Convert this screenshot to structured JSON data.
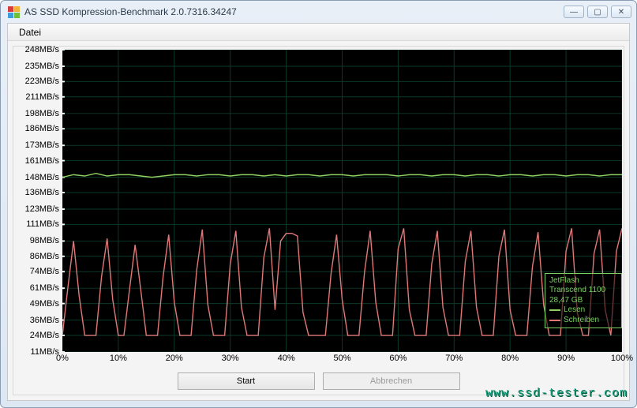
{
  "window": {
    "title": "AS SSD Kompression-Benchmark 2.0.7316.34247",
    "icon_colors": [
      "#d93b3b",
      "#f2b233",
      "#3b9dd9",
      "#6fbf3b"
    ]
  },
  "menu": {
    "file": "Datei"
  },
  "buttons": {
    "start": "Start",
    "cancel": "Abbrechen"
  },
  "win_controls": {
    "min": "—",
    "max": "▢",
    "close": "✕"
  },
  "legend": {
    "device": "JetFlash Transcend 1100",
    "capacity": "28,47 GB",
    "read": "Lesen",
    "write": "Schreiben",
    "read_color": "#8fd060",
    "write_color": "#e07878"
  },
  "watermark": "www.ssd-tester.com",
  "chart_data": {
    "type": "line",
    "title": "",
    "xlabel": "",
    "ylabel": "",
    "x_unit": "%",
    "y_unit": "MB/s",
    "xlim": [
      0,
      100
    ],
    "ylim": [
      11,
      248
    ],
    "x_ticks": [
      0,
      10,
      20,
      30,
      40,
      50,
      60,
      70,
      80,
      90,
      100
    ],
    "y_ticks": [
      11,
      24,
      36,
      49,
      61,
      74,
      86,
      98,
      111,
      123,
      136,
      148,
      161,
      173,
      186,
      198,
      211,
      223,
      235,
      248
    ],
    "y_tick_labels": [
      "11MB/s",
      "24MB/s",
      "36MB/s",
      "49MB/s",
      "61MB/s",
      "74MB/s",
      "86MB/s",
      "98MB/s",
      "111MB/s",
      "123MB/s",
      "136MB/s",
      "148MB/s",
      "161MB/s",
      "173MB/s",
      "186MB/s",
      "198MB/s",
      "211MB/s",
      "223MB/s",
      "235MB/s",
      "248MB/s"
    ],
    "x_tick_labels": [
      "0%",
      "10%",
      "20%",
      "30%",
      "40%",
      "50%",
      "60%",
      "70%",
      "80%",
      "90%",
      "100%"
    ],
    "series": [
      {
        "name": "Lesen",
        "color": "#8fd060",
        "x": [
          0,
          2,
          4,
          6,
          8,
          10,
          12,
          14,
          16,
          18,
          20,
          22,
          24,
          26,
          28,
          30,
          32,
          34,
          36,
          38,
          40,
          42,
          44,
          46,
          48,
          50,
          52,
          54,
          56,
          58,
          60,
          62,
          64,
          66,
          68,
          70,
          72,
          74,
          76,
          78,
          80,
          82,
          84,
          86,
          88,
          90,
          92,
          94,
          96,
          98,
          100
        ],
        "y": [
          148,
          150,
          149,
          151,
          149,
          150,
          150,
          149,
          148,
          149,
          150,
          150,
          149,
          150,
          150,
          149,
          150,
          150,
          149,
          150,
          149,
          150,
          150,
          149,
          150,
          150,
          149,
          150,
          150,
          150,
          149,
          150,
          150,
          149,
          150,
          150,
          149,
          150,
          150,
          149,
          150,
          150,
          149,
          150,
          150,
          149,
          150,
          150,
          149,
          150,
          150
        ]
      },
      {
        "name": "Schreiben",
        "color": "#e07878",
        "x": [
          0,
          1,
          2,
          3,
          4,
          5,
          6,
          7,
          8,
          9,
          10,
          11,
          12,
          13,
          14,
          15,
          16,
          17,
          18,
          19,
          20,
          21,
          22,
          23,
          24,
          25,
          26,
          27,
          28,
          29,
          30,
          31,
          32,
          33,
          34,
          35,
          36,
          37,
          38,
          39,
          40,
          41,
          42,
          43,
          44,
          45,
          46,
          47,
          48,
          49,
          50,
          51,
          52,
          53,
          54,
          55,
          56,
          57,
          58,
          59,
          60,
          61,
          62,
          63,
          64,
          65,
          66,
          67,
          68,
          69,
          70,
          71,
          72,
          73,
          74,
          75,
          76,
          77,
          78,
          79,
          80,
          81,
          82,
          83,
          84,
          85,
          86,
          87,
          88,
          89,
          90,
          91,
          92,
          93,
          94,
          95,
          96,
          97,
          98,
          99,
          100
        ],
        "y": [
          24,
          62,
          98,
          55,
          24,
          24,
          24,
          70,
          100,
          52,
          24,
          24,
          60,
          95,
          60,
          24,
          24,
          24,
          70,
          103,
          50,
          24,
          24,
          24,
          75,
          107,
          48,
          24,
          24,
          24,
          80,
          106,
          46,
          24,
          24,
          24,
          85,
          108,
          44,
          98,
          104,
          104,
          102,
          42,
          24,
          24,
          24,
          24,
          72,
          103,
          52,
          24,
          24,
          24,
          74,
          106,
          50,
          24,
          24,
          24,
          92,
          108,
          44,
          24,
          24,
          24,
          80,
          106,
          46,
          24,
          24,
          24,
          82,
          106,
          46,
          24,
          24,
          24,
          86,
          107,
          44,
          24,
          24,
          24,
          78,
          105,
          48,
          24,
          24,
          24,
          90,
          108,
          42,
          24,
          24,
          88,
          107,
          44,
          24,
          90,
          108
        ]
      }
    ]
  }
}
